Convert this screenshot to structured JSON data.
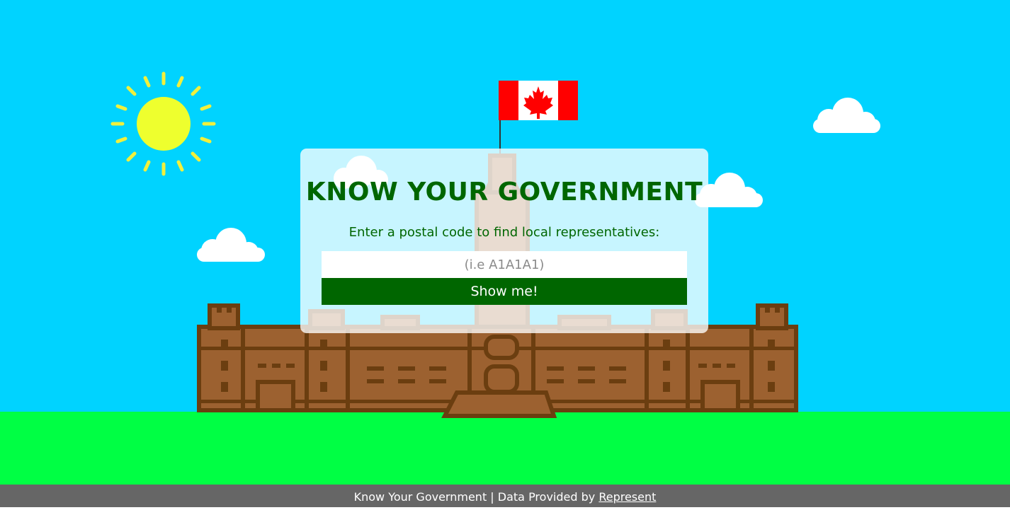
{
  "app": {
    "title": "KNOW YOUR GOVERNMENT"
  },
  "colors": {
    "sky": "#00d3ff",
    "grass": "#00ff44",
    "brand_green": "#006600",
    "footer_bg": "#666666",
    "building": "#9c6130",
    "building_dark": "#6b3e10"
  },
  "form": {
    "prompt": "Enter a postal code to find local representatives:",
    "postal_placeholder": "(i.e A1A1A1)",
    "postal_value": "",
    "submit_label": "Show me!"
  },
  "footer": {
    "text": "Know Your Government | Data Provided by",
    "link_label": "Represent"
  },
  "scene": {
    "icons": [
      "sun-icon",
      "cloud-icon",
      "canada-flag-icon",
      "parliament-building-illustration"
    ]
  }
}
